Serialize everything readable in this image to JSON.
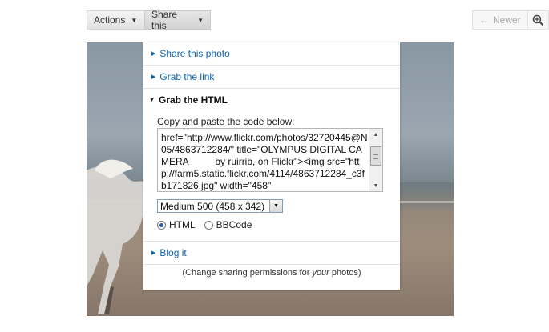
{
  "toolbar": {
    "actions_label": "Actions",
    "share_label": "Share this",
    "newer_label": "Newer"
  },
  "share_panel": {
    "share_photo_label": "Share this photo",
    "grab_link_label": "Grab the link",
    "grab_html_label": "Grab the HTML",
    "copy_label": "Copy and paste the code below:",
    "code": "href=\"http://www.flickr.com/photos/32720445@N05/4863712284/\" title=\"OLYMPUS DIGITAL CAMERA          by ruirrib, on Flickr\"><img src=\"http://farm5.static.flickr.com/4114/4863712284_c3fb171826.jpg\" width=\"458\"",
    "size_selected": "Medium 500 (458 x 342)",
    "format_options": [
      "HTML",
      "BBCode"
    ],
    "format_selected": "HTML",
    "blog_label": "Blog it",
    "footer_prefix": "(Change sharing permissions for ",
    "footer_emph": "your",
    "footer_suffix": " photos)"
  },
  "icons": {
    "zoom": "magnifier-plus-icon",
    "newer": "left-arrow-icon"
  }
}
